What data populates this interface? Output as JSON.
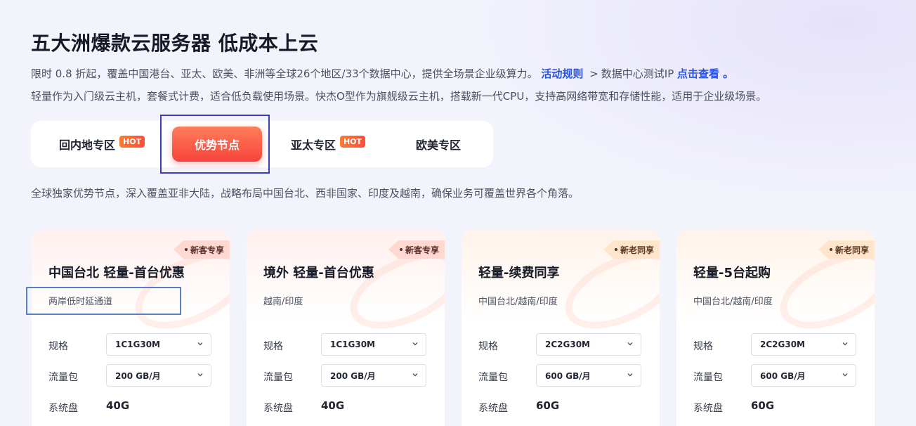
{
  "header": {
    "title": "五大洲爆款云服务器 低成本上云",
    "desc1_main": "限时 0.8 折起，覆盖中国港台、亚太、欧美、非洲等全球26个地区/33个数据中心，提供全场景企业级算力。",
    "desc1_rules_link": "活动规则",
    "desc1_gt": ">",
    "desc1_ip_text": "数据中心测试IP",
    "desc1_view_link": "点击查看 。",
    "desc2": "轻量作为入门级云主机，套餐式计费，适合低负载使用场景。快杰O型作为旗舰级云主机，搭载新一代CPU，支持高网络带宽和存储性能，适用于企业级场景。"
  },
  "tabs": [
    {
      "label": "回内地专区",
      "hot": "HOT"
    },
    {
      "label": "优势节点",
      "hot": ""
    },
    {
      "label": "亚太专区",
      "hot": "HOT"
    },
    {
      "label": "欧美专区",
      "hot": ""
    }
  ],
  "active_tab": "优势节点",
  "subdesc": "全球独家优势节点，深入覆盖亚非大陆，战略布局中国台北、西非国家、印度及越南，确保业务可覆盖世界各个角落。",
  "labels": {
    "spec": "规格",
    "traffic": "流量包",
    "disk": "系统盘"
  },
  "cards": [
    {
      "badge": "新客专享",
      "title": "中国台北 轻量-首台优惠",
      "sub": "两岸低时延通道",
      "spec": "1C1G30M",
      "traffic": "200 GB/月",
      "disk": "40G"
    },
    {
      "badge": "新客专享",
      "title": "境外 轻量-首台优惠",
      "sub": "越南/印度",
      "spec": "1C1G30M",
      "traffic": "200 GB/月",
      "disk": "40G"
    },
    {
      "badge": "新老同享",
      "title": "轻量-续费同享",
      "sub": "中国台北/越南/印度",
      "spec": "2C2G30M",
      "traffic": "600 GB/月",
      "disk": "60G"
    },
    {
      "badge": "新老同享",
      "title": "轻量-5台起购",
      "sub": "中国台北/越南/印度",
      "spec": "2C2G30M",
      "traffic": "600 GB/月",
      "disk": "60G"
    }
  ],
  "colors": {
    "accent_blue": "#2a53e0",
    "active_tab_top": "#ff7e5a",
    "active_tab_bottom": "#f6433b",
    "hot_badge": "#ff4d3b"
  }
}
